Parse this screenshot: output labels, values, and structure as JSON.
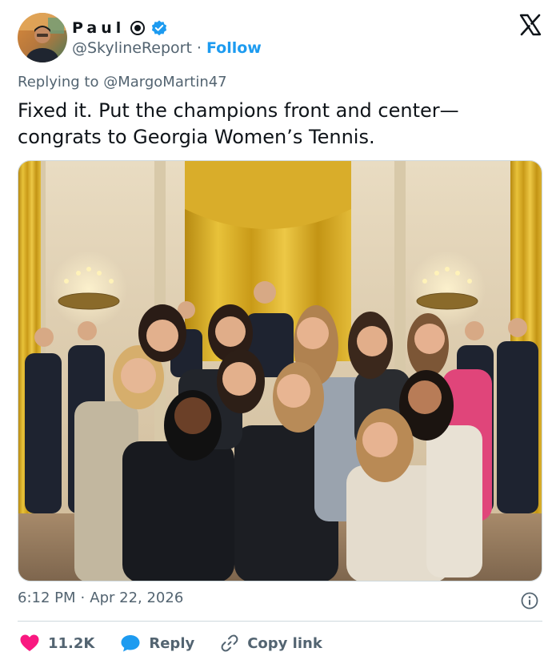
{
  "header": {
    "display_name": "Paul",
    "handle": "@SkylineReport",
    "separator": "·",
    "follow_label": "Follow"
  },
  "reply": {
    "prefix": "Replying to",
    "mention": "@MargoMartin47"
  },
  "tweet": {
    "line1": "Fixed it. Put the champions front and center—",
    "line2": "congrats to Georgia Women’s Tennis."
  },
  "meta": {
    "time": "6:12 PM",
    "separator": "·",
    "date": "Apr 22, 2026"
  },
  "actions": {
    "likes": "11.2K",
    "reply_label": "Reply",
    "copy_link_label": "Copy link"
  },
  "colors": {
    "accent": "#1d9bf0",
    "like": "#f91880",
    "muted": "#536471"
  },
  "icons": {
    "verified": "verified-badge-icon",
    "x_logo": "x-logo-icon",
    "info": "info-icon",
    "like": "heart-icon",
    "reply": "speech-bubble-icon",
    "copy_link": "link-icon"
  }
}
